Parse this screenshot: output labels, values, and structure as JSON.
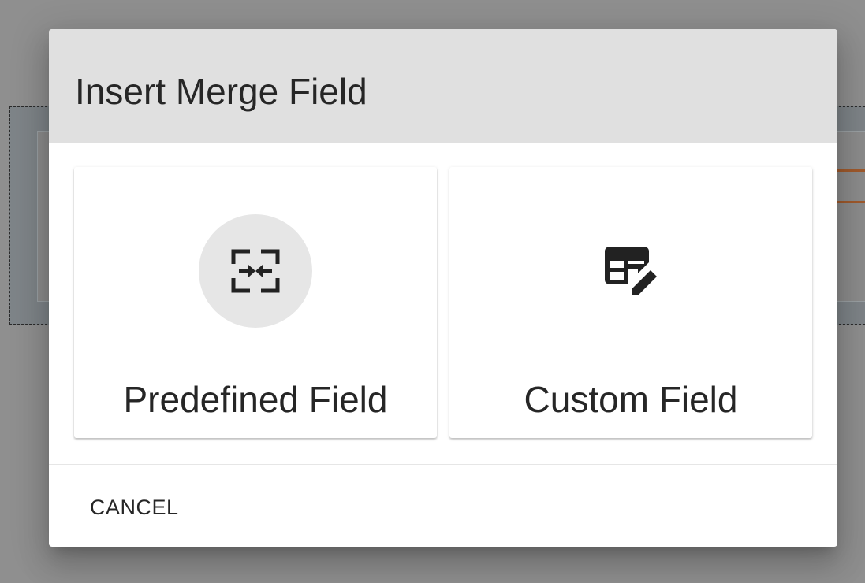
{
  "dialog": {
    "title": "Insert Merge Field",
    "options": [
      {
        "label": "Predefined Field",
        "icon": "merge-fields-icon"
      },
      {
        "label": "Custom Field",
        "icon": "table-edit-icon"
      }
    ],
    "cancel_label": "CANCEL"
  },
  "colors": {
    "header_bg": "#e0e0e0",
    "text": "#262626",
    "icon_circle_bg": "#e6e6e6",
    "backdrop": "#8f8f8f"
  }
}
